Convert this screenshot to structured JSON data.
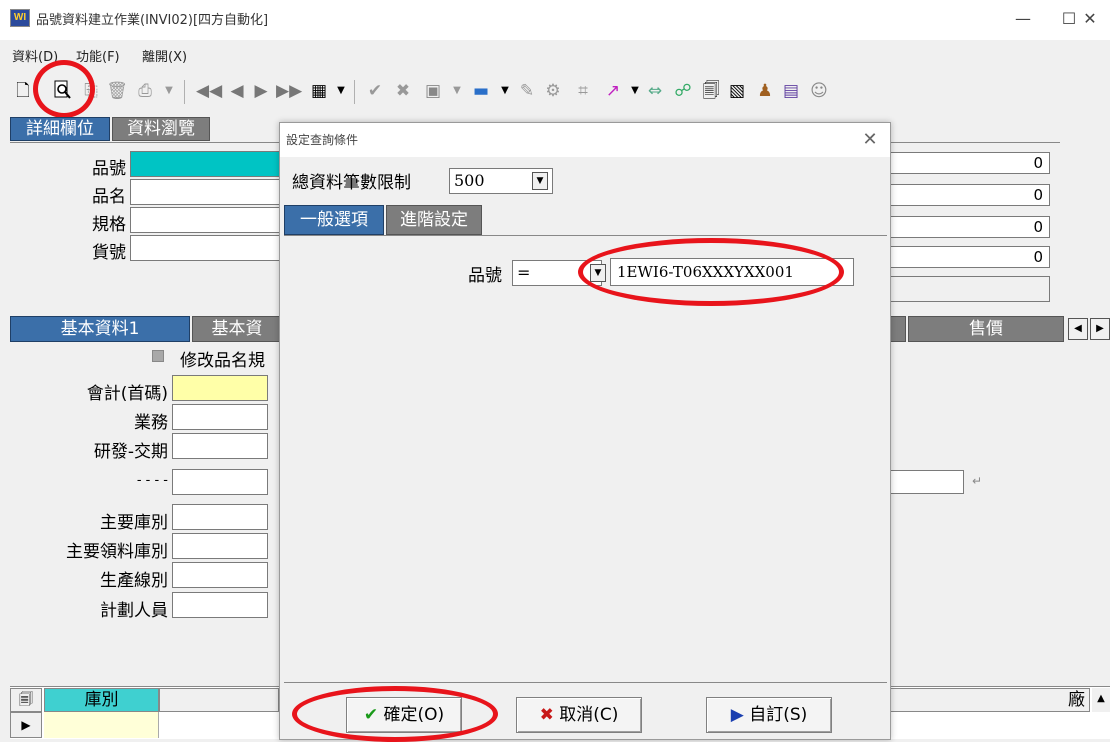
{
  "window": {
    "title": "品號資料建立作業(INVI02)[四方自動化]",
    "logo_text": "WI",
    "minimize_glyph": "—",
    "maximize_glyph": "☐",
    "close_glyph": "✕"
  },
  "menu": {
    "items": [
      "資料(D)",
      "功能(F)",
      "離開(X)"
    ]
  },
  "main_tabs": {
    "detail": "詳細欄位",
    "browse": "資料瀏覽"
  },
  "main_form": {
    "labels": [
      "品號",
      "品名",
      "規格",
      "貨號"
    ],
    "right_values": [
      "0",
      "0",
      "0",
      "0"
    ]
  },
  "sub_tabs": {
    "basic1": "基本資料1",
    "basic2": "基本資",
    "price": "售價"
  },
  "basic_form": {
    "checkbox_label": "修改品名規",
    "labels": [
      "會計(首碼)",
      "業務",
      "研發-交期",
      "- - - -",
      "主要庫別",
      "主要領料庫別",
      "生產線別",
      "計劃人員"
    ]
  },
  "grid": {
    "col_warehouse": "庫別",
    "col_vendor": "廠"
  },
  "dialog": {
    "title": "設定查詢條件",
    "close_glyph": "✕",
    "limit_label": "總資料筆數限制",
    "limit_value": "500",
    "tab_general": "一般選項",
    "tab_advanced": "進階設定",
    "field_label": "品號",
    "operator": "=",
    "field_value": "1EWI6-T06XXXYXX001",
    "ok_label": "確定(O)",
    "cancel_label": "取消(C)",
    "custom_label": "自訂(S)"
  },
  "colors": {
    "annotation_red": "#e8141b",
    "active_tab": "#3b6fa9",
    "cyan_field": "#00c4c4",
    "yellow_field": "#ffffa8"
  }
}
